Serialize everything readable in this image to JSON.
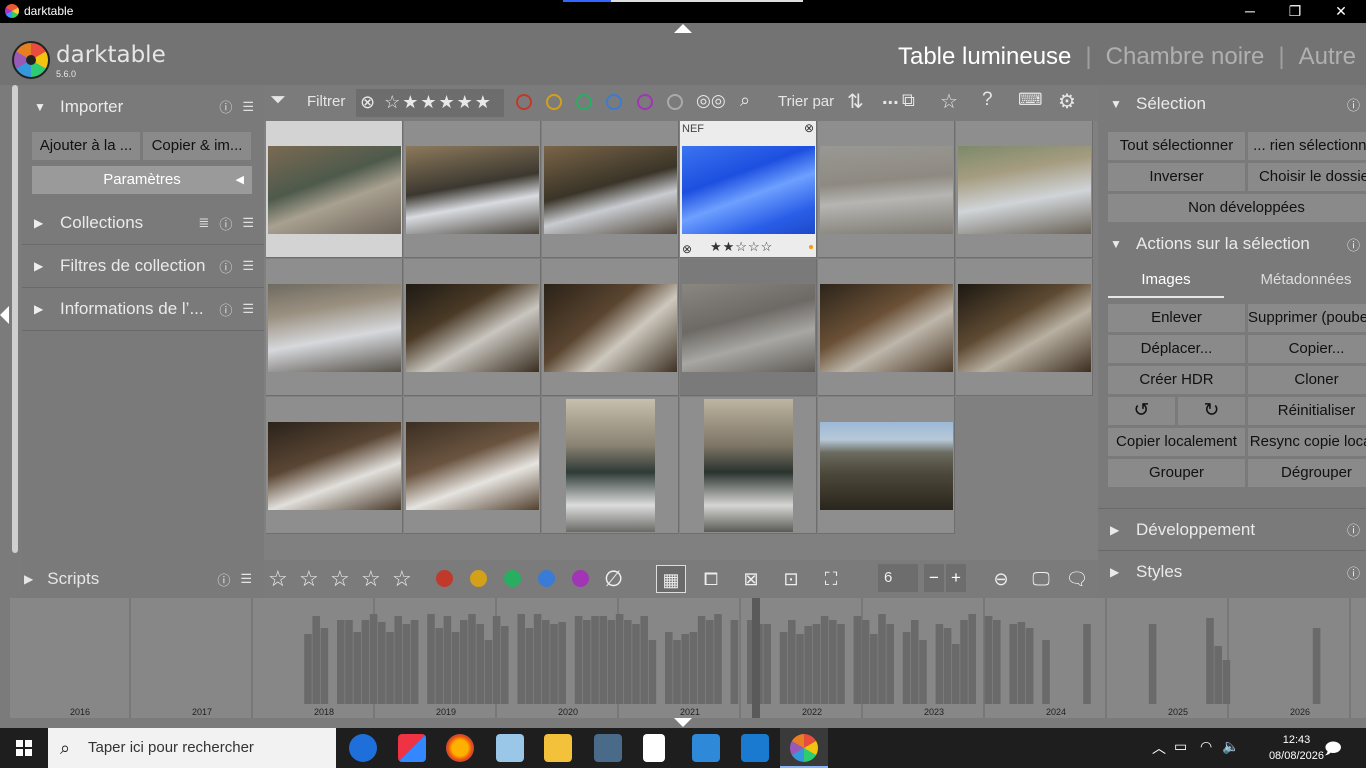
{
  "window": {
    "title": "darktable",
    "minimize": "─",
    "maximize": "❐",
    "close": "✕"
  },
  "app": {
    "name": "darktable",
    "version": "5.6.0"
  },
  "views": {
    "lighttable": "Table lumineuse",
    "darkroom": "Chambre noire",
    "other": "Autre",
    "sep": "|"
  },
  "left": {
    "import": {
      "title": "Importer",
      "btn_add": "Ajouter à la ...",
      "btn_copy": "Copier & im...",
      "params": "Paramètres"
    },
    "collections": "Collections",
    "collection_filters": "Filtres de collection",
    "info": "Informations de l’...",
    "scripts": "Scripts"
  },
  "filterbar": {
    "filter": "Filtrer",
    "stars": "⊗ ☆★★★★★",
    "sort": "Trier par",
    "more": "..."
  },
  "colors": {
    "red": "#c0392b",
    "yellow": "#d4a017",
    "green": "#27ae60",
    "blue": "#3a7bd5",
    "purple": "#a235b5",
    "gray": "#bbbbbb"
  },
  "thumbs": [
    {
      "ext": "",
      "rating": ""
    },
    {
      "ext": "",
      "rating": ""
    },
    {
      "ext": "",
      "rating": ""
    },
    {
      "ext": "NEF",
      "rating": "★★☆☆☆"
    },
    {
      "ext": "",
      "rating": ""
    },
    {
      "ext": "",
      "rating": ""
    }
  ],
  "zoom": {
    "value": "6",
    "minus": "−",
    "plus": "+"
  },
  "right": {
    "selection": {
      "title": "Sélection",
      "select_all": "Tout sélectionner",
      "select_none": "... rien sélectionner",
      "invert": "Inverser",
      "choose_folder": "Choisir le dossier",
      "not_developed": "Non développées"
    },
    "actions": {
      "title": "Actions sur la sélection",
      "tab_images": "Images",
      "tab_metadata": "Métadonnées",
      "buttons": [
        "Enlever",
        "Supprimer (poubelle)",
        "Déplacer...",
        "Copier...",
        "Créer HDR",
        "Cloner",
        "↺",
        "↻",
        "Réinitialiser",
        "Copier localement",
        "Resync copie locale",
        "Grouper",
        "Dégrouper"
      ]
    },
    "develop": "Développement",
    "styles": "Styles"
  },
  "timeline": {
    "years": [
      "2016",
      "2017",
      "2018",
      "2019",
      "2020",
      "2021",
      "2022",
      "2023",
      "2024",
      "2025",
      "2026"
    ]
  },
  "taskbar": {
    "search_placeholder": "Taper ici pour rechercher",
    "time": "12:43",
    "date": "08/08/2026"
  }
}
